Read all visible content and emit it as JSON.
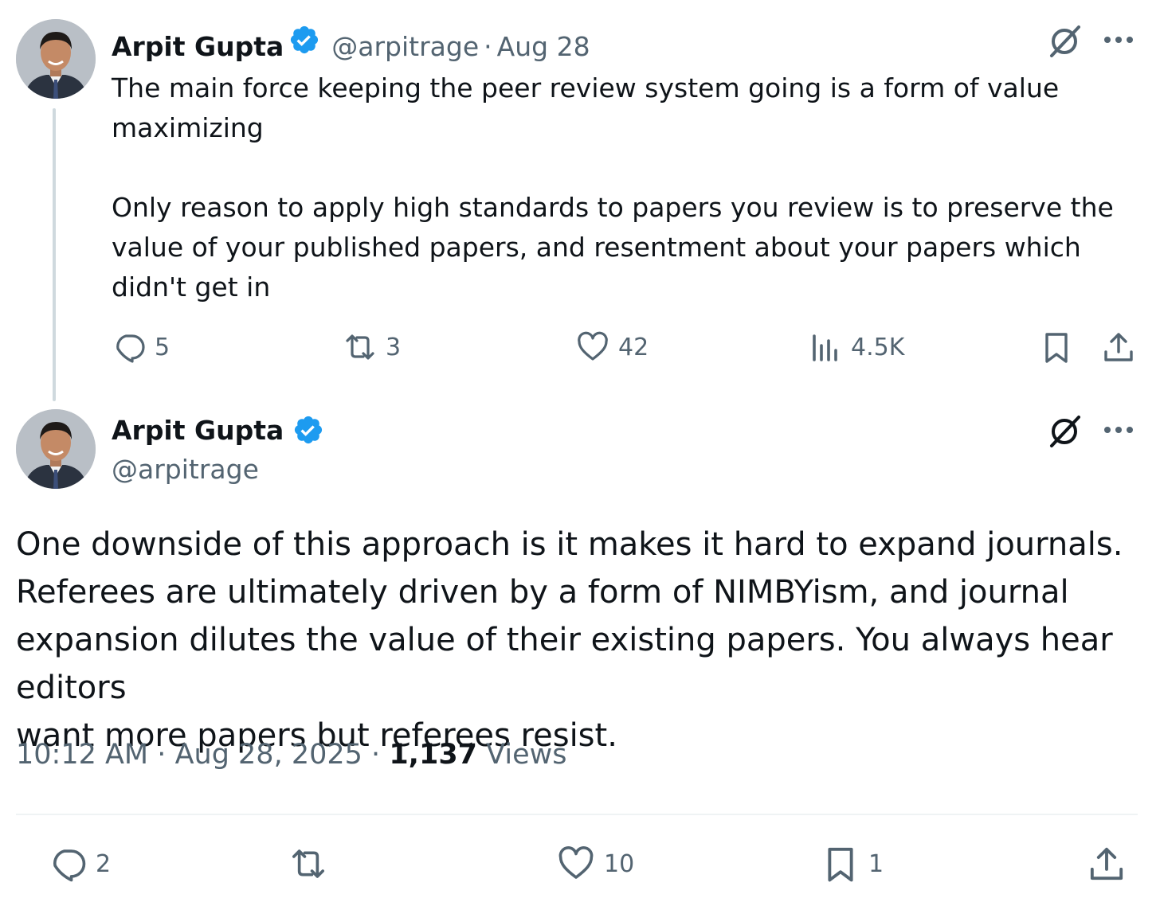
{
  "tweet1": {
    "author_name": "Arpit Gupta",
    "handle": "@arpitrage",
    "separator": "·",
    "date": "Aug 28",
    "paragraph1": "The main force keeping the peer review system going is a form of value\nmaximizing",
    "paragraph2": "Only reason to apply high standards to papers you review is to preserve the\nvalue of your published papers, and resentment about your papers which\ndidn't get in",
    "actions": {
      "replies": "5",
      "reposts": "3",
      "likes": "42",
      "views": "4.5K"
    }
  },
  "tweet2": {
    "author_name": "Arpit Gupta",
    "handle": "@arpitrage",
    "body": "One downside of this approach is it makes it hard to expand journals.\nReferees are ultimately driven by a form of NIMBYism, and journal\nexpansion dilutes the value of their existing papers. You always hear editors\nwant more papers but referees resist.",
    "time": "10:12 AM",
    "date": "Aug 28, 2025",
    "separator": "·",
    "views_count": "1,137",
    "views_label": "Views",
    "actions": {
      "replies": "2",
      "likes": "10",
      "bookmarks": "1"
    }
  },
  "colors": {
    "text": "#0f1419",
    "secondary": "#536471",
    "verified": "#1d9bf0",
    "thread_line": "#cfd9de"
  },
  "icons": [
    "verified-badge-icon",
    "grok-icon",
    "more-icon",
    "reply-icon",
    "repost-icon",
    "like-icon",
    "views-icon",
    "bookmark-icon",
    "share-icon"
  ]
}
